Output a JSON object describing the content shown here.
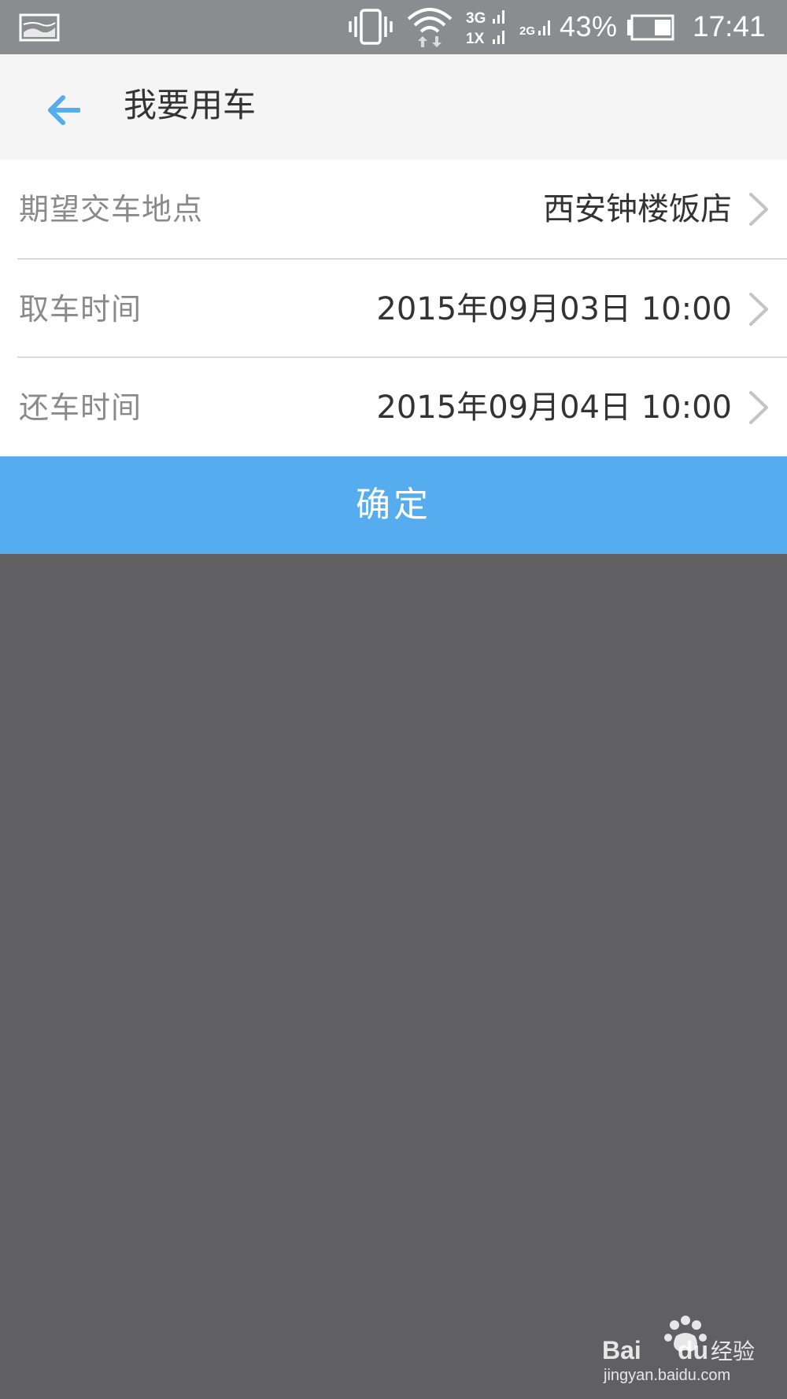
{
  "status_bar": {
    "battery_percent": "43%",
    "time": "17:41",
    "icons": [
      "gallery-icon",
      "vibrate-icon",
      "wifi-icon",
      "signal-3g-1x-icon",
      "signal-2g-icon",
      "battery-icon"
    ],
    "signal_3g_label": "3G",
    "signal_1x_label": "1X",
    "signal_2g_label": "2G",
    "battery_level": 0.43
  },
  "header": {
    "back_icon": "back-arrow-icon",
    "title": "我要用车"
  },
  "form": {
    "rows": [
      {
        "label": "期望交车地点",
        "value": "西安钟楼饭店"
      },
      {
        "label": "取车时间",
        "value": "2015年09月03日 10:00"
      },
      {
        "label": "还车时间",
        "value": "2015年09月04日 10:00"
      }
    ]
  },
  "confirm_button": {
    "label": "确定"
  },
  "watermark": {
    "brand": "Bai du 经验",
    "url": "jingyan.baidu.com"
  },
  "colors": {
    "accent": "#55acee",
    "status_bar": "#8a8c90",
    "overlay": "#606062",
    "header_bg": "#f5f5f5"
  }
}
